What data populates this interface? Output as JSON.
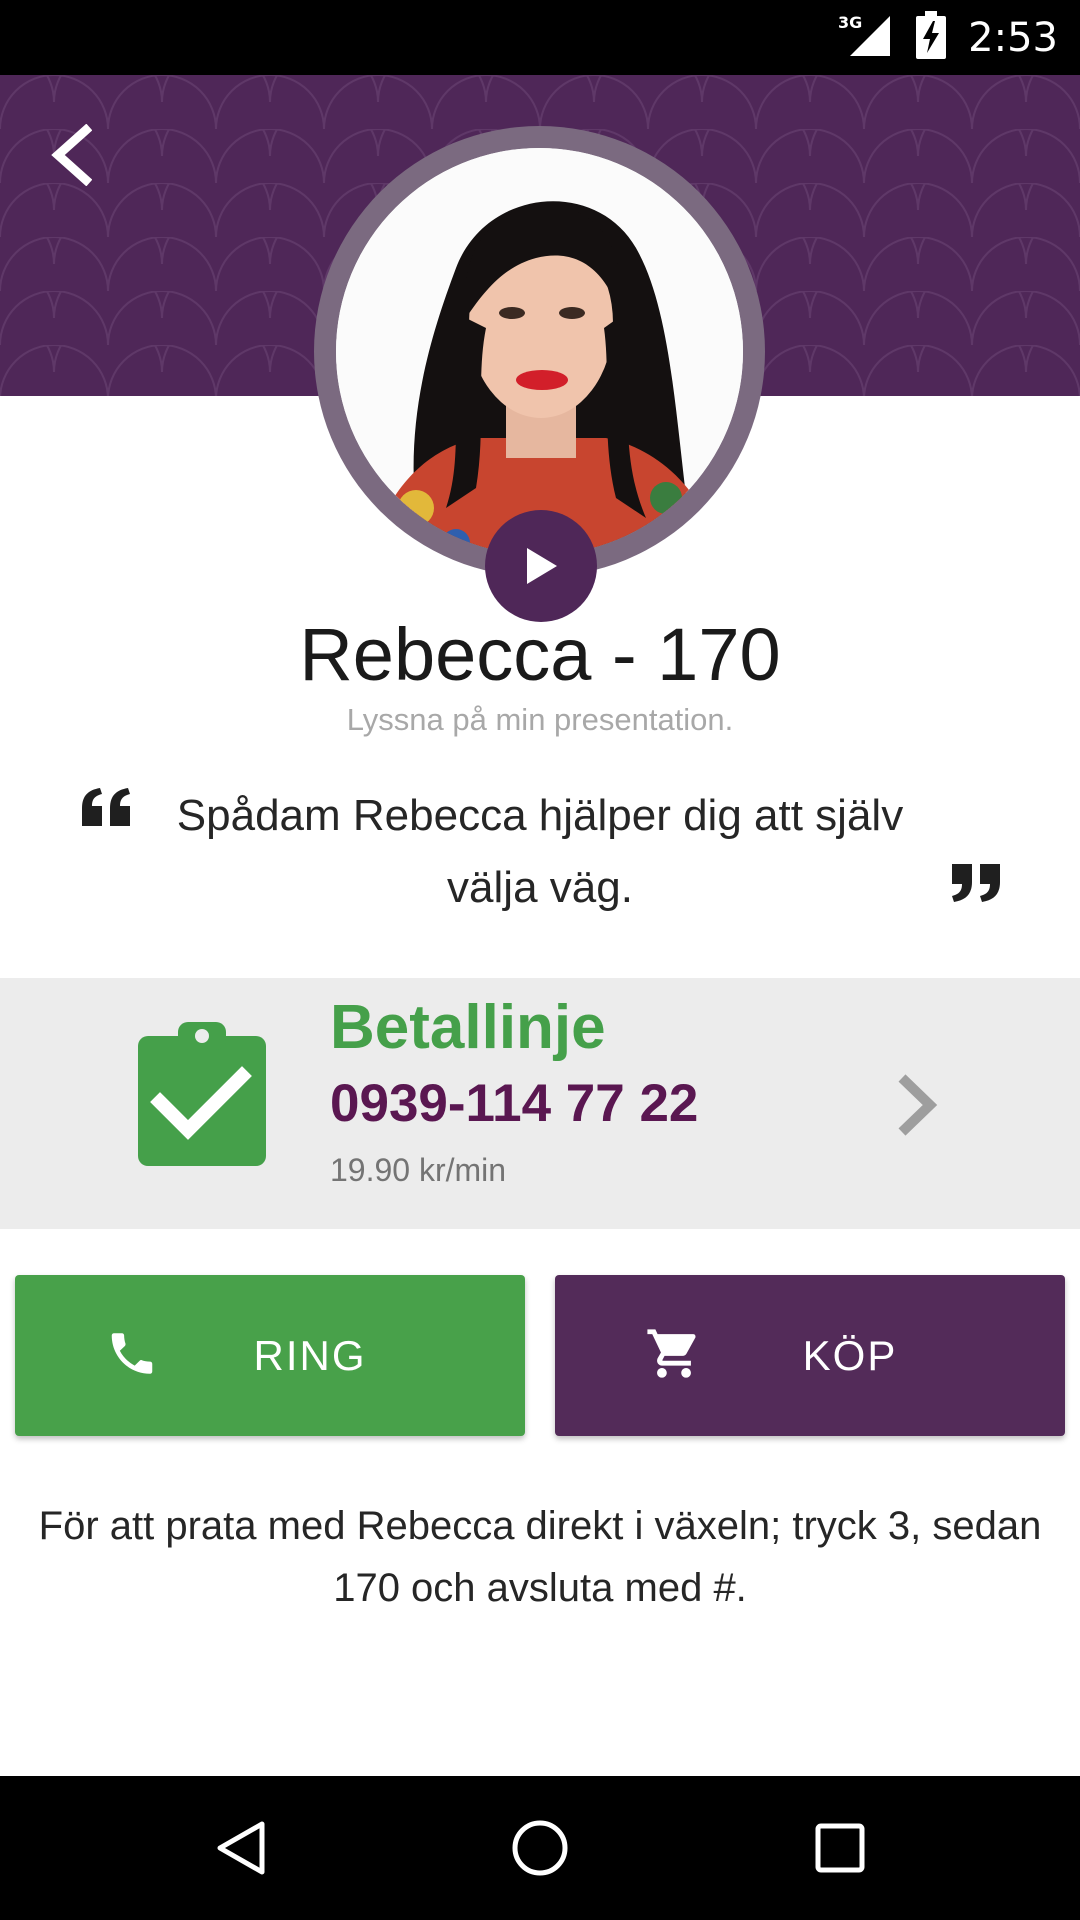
{
  "status_bar": {
    "network": "3G",
    "time": "2:53"
  },
  "header": {
    "back_icon": "chevron-left-icon"
  },
  "profile": {
    "name": "Rebecca - 170",
    "subtitle": "Lyssna på min presentation.",
    "quote": "Spådam Rebecca hjälper dig att själv välja väg."
  },
  "payment": {
    "title": "Betallinje",
    "number": "0939-114 77 22",
    "rate": "19.90 kr/min",
    "icon": "clipboard-check-icon"
  },
  "actions": {
    "ring_label": "RING",
    "kop_label": "KÖP"
  },
  "instructions": "För att prata med Rebecca direkt i växeln; tryck 3, sedan 170 och avsluta med #.",
  "colors": {
    "brand_purple": "#4f2758",
    "green": "#48a14a",
    "number_purple": "#5a1751"
  }
}
